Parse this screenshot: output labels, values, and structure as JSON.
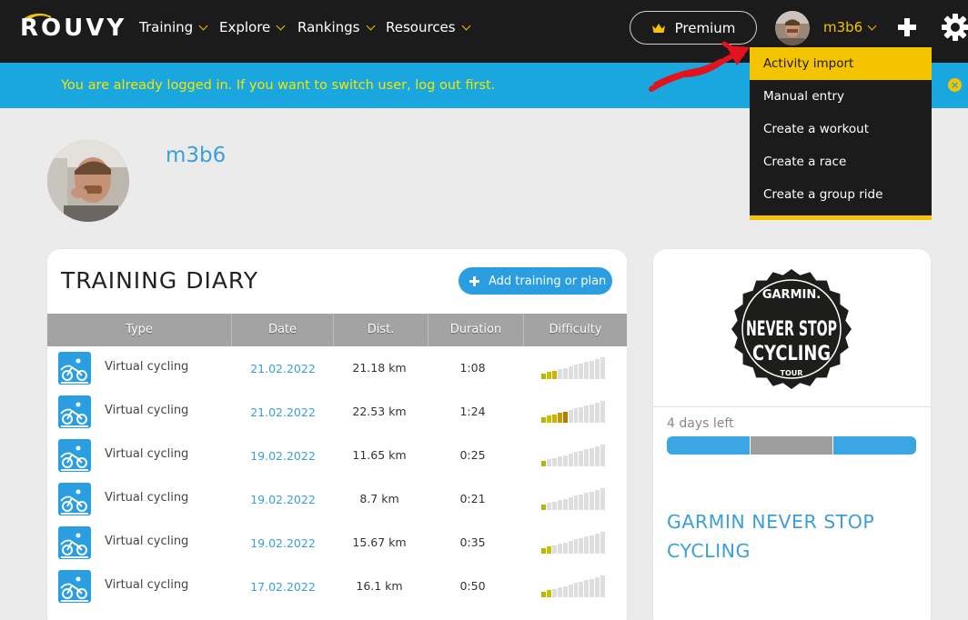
{
  "nav": {
    "brand": "ROUVY",
    "items": [
      {
        "label": "Training"
      },
      {
        "label": "Explore"
      },
      {
        "label": "Rankings"
      },
      {
        "label": "Resources"
      }
    ],
    "premium_label": "Premium",
    "username": "m3b6"
  },
  "banner": {
    "message": "You are already logged in. If you want to switch user, log out first.",
    "close_icon": "close-icon"
  },
  "dropdown": {
    "items": [
      {
        "label": "Activity import",
        "active": true
      },
      {
        "label": "Manual entry"
      },
      {
        "label": "Create a workout"
      },
      {
        "label": "Create a race"
      },
      {
        "label": "Create a group ride"
      }
    ]
  },
  "profile": {
    "name": "m3b6"
  },
  "diary": {
    "title": "TRAINING DIARY",
    "add_button_label": "Add training or plan",
    "columns": [
      "Type",
      "Date",
      "Dist.",
      "Duration",
      "Difficulty"
    ],
    "rows": [
      {
        "type": "Virtual cycling",
        "date": "21.02.2022",
        "distance": "21.18 km",
        "duration": "1:08",
        "difficulty": 3
      },
      {
        "type": "Virtual cycling",
        "date": "21.02.2022",
        "distance": "22.53 km",
        "duration": "1:24",
        "difficulty": 5
      },
      {
        "type": "Virtual cycling",
        "date": "19.02.2022",
        "distance": "11.65 km",
        "duration": "0:25",
        "difficulty": 1
      },
      {
        "type": "Virtual cycling",
        "date": "19.02.2022",
        "distance": "8.7 km",
        "duration": "0:21",
        "difficulty": 1
      },
      {
        "type": "Virtual cycling",
        "date": "19.02.2022",
        "distance": "15.67 km",
        "duration": "0:35",
        "difficulty": 2
      },
      {
        "type": "Virtual cycling",
        "date": "17.02.2022",
        "distance": "16.1 km",
        "duration": "0:50",
        "difficulty": 2
      }
    ],
    "difficulty_max": 12
  },
  "event": {
    "badge": {
      "brand": "GARMIN.",
      "line1": "NEVER STOP",
      "line2": "CYCLING",
      "line3": "TOUR"
    },
    "days_left": "4 days left",
    "title": "GARMIN NEVER STOP CYCLING",
    "progress_segments": [
      "#3aa6e3",
      "#9e9e9e",
      "#3aa6e3"
    ]
  },
  "colors": {
    "accent_yellow": "#f5c400",
    "accent_blue": "#2a9ee0",
    "link_blue": "#3b9fd8",
    "banner_blue": "#1aa7e0",
    "dark": "#1b1b1b"
  }
}
